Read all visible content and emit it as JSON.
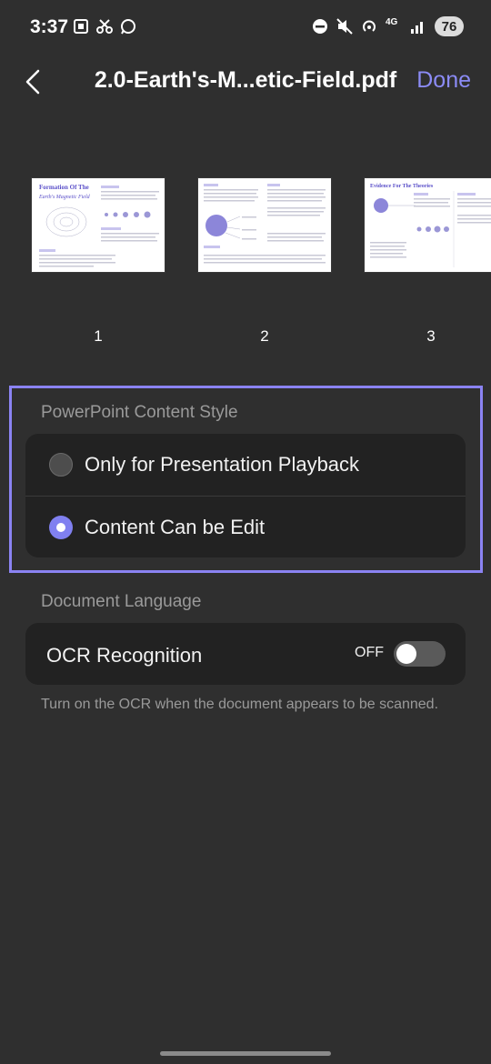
{
  "status_bar": {
    "time": "3:37",
    "battery": "76",
    "network": "4G"
  },
  "header": {
    "title": "2.0-Earth's-M...etic-Field.pdf",
    "done_label": "Done"
  },
  "thumbnails": [
    {
      "page": "1",
      "heading": "Formation Of The",
      "subheading": "Earth's Magnetic Field"
    },
    {
      "page": "2",
      "heading": "",
      "subheading": ""
    },
    {
      "page": "3",
      "heading": "Evidence For The Theories",
      "subheading": ""
    }
  ],
  "content_style": {
    "label": "PowerPoint Content Style",
    "options": [
      {
        "label": "Only for Presentation Playback",
        "selected": false
      },
      {
        "label": "Content Can be Edit",
        "selected": true
      }
    ]
  },
  "language": {
    "label": "Document Language",
    "ocr_label": "OCR Recognition",
    "ocr_state": "OFF",
    "hint": "Turn on the OCR when the document appears to be scanned."
  },
  "colors": {
    "accent": "#8b8bf5",
    "highlight_border": "#8b83f3",
    "background": "#2f2f2f",
    "card": "#222222"
  }
}
